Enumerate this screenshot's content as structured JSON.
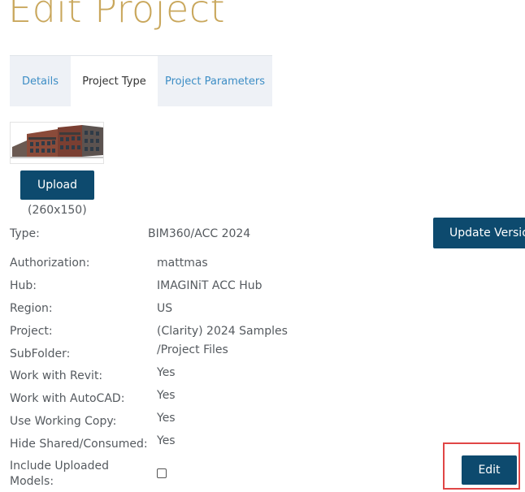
{
  "page": {
    "title": "Edit Project"
  },
  "tabs": [
    {
      "label": "Details",
      "active": false
    },
    {
      "label": "Project Type",
      "active": true
    },
    {
      "label": "Project Parameters",
      "active": false
    }
  ],
  "image": {
    "upload_label": "Upload",
    "size_hint": "(260x150)"
  },
  "type_row": {
    "label": "Type:",
    "value": "BIM360/ACC 2024",
    "update_label": "Update Versio"
  },
  "fields": {
    "authorization": {
      "label": "Authorization:",
      "value": "mattmas"
    },
    "hub": {
      "label": "Hub:",
      "value": "IMAGINiT ACC Hub"
    },
    "region": {
      "label": "Region:",
      "value": "US"
    },
    "project": {
      "label": "Project:",
      "value": "(Clarity) 2024 Samples"
    },
    "subfolder": {
      "label": "SubFolder:",
      "value": "/Project Files"
    },
    "revit": {
      "label": "Work with Revit:",
      "value": "Yes"
    },
    "autocad": {
      "label": "Work with AutoCAD:",
      "value": "Yes"
    },
    "working_copy": {
      "label": "Use Working Copy:",
      "value": "Yes"
    },
    "hide_shared": {
      "label": "Hide Shared/Consumed:",
      "value": "Yes"
    },
    "include_uploaded": {
      "label_line1": "Include Uploaded",
      "label_line2": "Models:",
      "checked": false
    }
  },
  "actions": {
    "edit_label": "Edit"
  },
  "colors": {
    "title": "#c9a75c",
    "primary_button": "#0d4a6e",
    "tab_link": "#3c8dc5",
    "highlight": "#e04646"
  }
}
